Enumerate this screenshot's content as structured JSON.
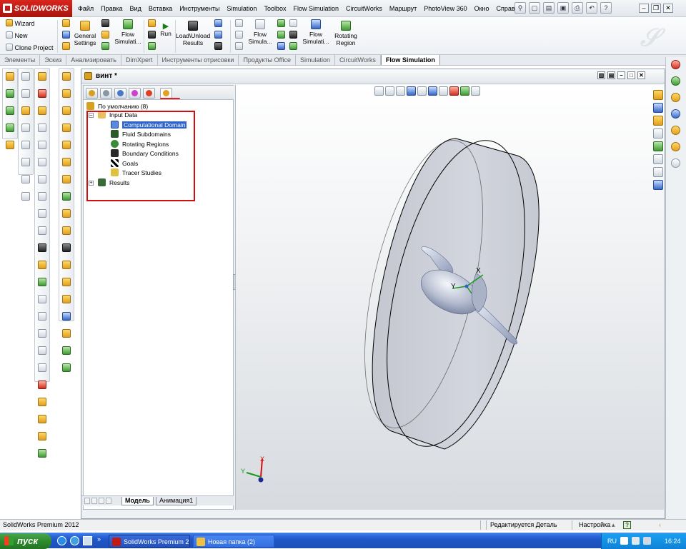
{
  "app": {
    "logo_text": "SOLIDWORKS"
  },
  "menu": [
    "Файл",
    "Правка",
    "Вид",
    "Вставка",
    "Инструменты",
    "Simulation",
    "Toolbox",
    "Flow Simulation",
    "CircuitWorks",
    "Маршрут",
    "PhotoView 360",
    "Окно",
    "Справка"
  ],
  "ribbon": {
    "wizard": "Wizard",
    "new": "New",
    "clone_project": "Clone Project",
    "general_settings": "General\nSettings",
    "flow_simulation_1": "Flow\nSimulati...",
    "run": "Run",
    "load_unload_results": "Load\\Unload\nResults",
    "flow_simulation_2": "Flow\nSimula...",
    "flow_simulation_3": "Flow\nSimulati...",
    "rotating_region": "Rotating\nRegion"
  },
  "command_tabs": [
    "Элементы",
    "Эскиз",
    "Анализировать",
    "DimXpert",
    "Инструменты отрисовки",
    "Продукты Office",
    "Simulation",
    "CircuitWorks",
    "Flow Simulation"
  ],
  "active_tab": "Flow Simulation",
  "document": {
    "title": "винт *"
  },
  "tree": {
    "root": "По умолчанию (8)",
    "input_data": "Input Data",
    "items": [
      "Computational Domain",
      "Fluid Subdomains",
      "Rotating Regions",
      "Boundary Conditions",
      "Goals",
      "Tracer Studies"
    ],
    "results": "Results",
    "selected": "Computational Domain"
  },
  "bottom_tabs": [
    "Модель",
    "Анимация1"
  ],
  "triad": {
    "x": "X",
    "y": "Y"
  },
  "model_triad": {
    "x": "X",
    "y": "Y"
  },
  "status": {
    "product": "SolidWorks Premium 2012",
    "editing": "Редактируется Деталь",
    "settings": "Настройка"
  },
  "taskbar": {
    "start": "пуск",
    "task1": "SolidWorks Premium 2...",
    "task2": "Новая папка (2)",
    "lang": "RU",
    "clock": "16:24"
  },
  "colors": {
    "accent_red": "#d01010",
    "selection_blue": "#2f64c8",
    "taskbar_blue": "#1f56c8"
  }
}
